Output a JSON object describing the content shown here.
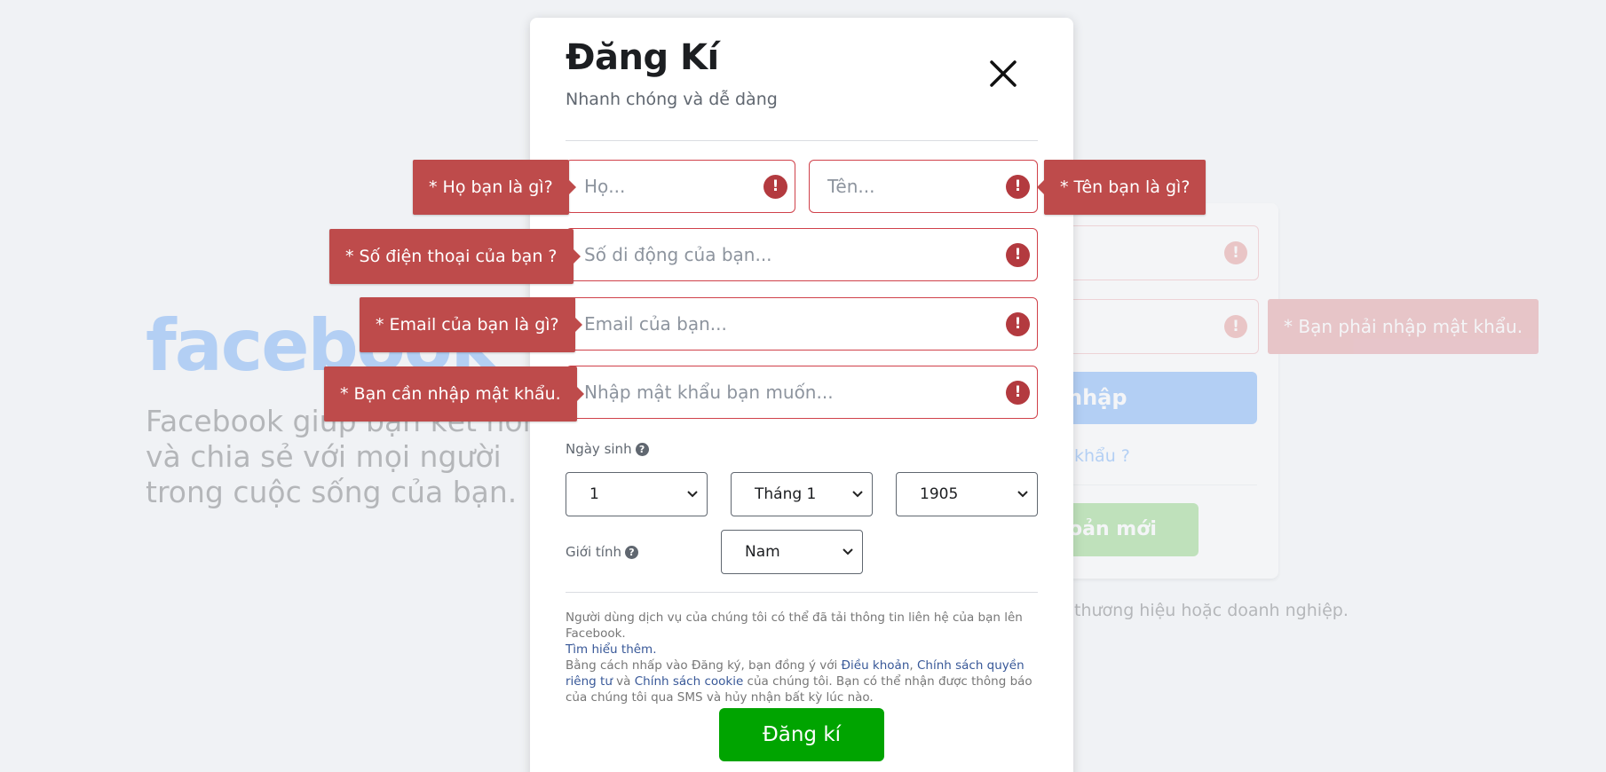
{
  "background": {
    "logo": "facebook",
    "tagline": "Facebook giúp bạn kết nối và chia sẻ với mọi người trong cuộc sống của bạn.",
    "password_tooltip": "* Bạn phải nhập mật khẩu.",
    "login_button": "nhập",
    "forgot_password": "khẩu ?",
    "create_account_button": "oản mới",
    "footer_note": "thương hiệu hoặc doanh nghiệp."
  },
  "modal": {
    "title": "Đăng Kí",
    "subtitle": "Nhanh chóng và dễ dàng",
    "fields": {
      "last_name": {
        "placeholder": "Họ...",
        "value": "",
        "error": "* Họ bạn là gì?"
      },
      "first_name": {
        "placeholder": "Tên...",
        "value": "",
        "error": "* Tên bạn là gì?"
      },
      "phone": {
        "placeholder": "Số di động của bạn...",
        "value": "",
        "error": "* Số điện thoại của bạn ?"
      },
      "email": {
        "placeholder": "Email của bạn...",
        "value": "",
        "error": "* Email của bạn là gì?"
      },
      "password": {
        "placeholder": "Nhập mật khẩu bạn muốn...",
        "value": "",
        "error": "* Bạn cần nhập mật khẩu."
      }
    },
    "alert_glyph": "!",
    "birthday": {
      "label": "Ngày sinh",
      "day": "1",
      "month": "Tháng 1",
      "year": "1905"
    },
    "gender": {
      "label": "Giới tính",
      "value": "Nam"
    },
    "help_glyph": "?",
    "legal": {
      "line1": "Người dùng dịch vụ của chúng tôi có thể đã tải thông tin liên hệ của bạn lên Facebook.",
      "learn_more": "Tìm hiểu thêm.",
      "line2_pre": "Bằng cách nhấp vào Đăng ký, bạn đồng ý với ",
      "terms": "Điều khoản",
      "sep": ", ",
      "privacy": "Chính sách quyền riêng tư",
      "and": " và ",
      "cookie": "Chính sách cookie",
      "line2_post": " của chúng tôi. Bạn có thể nhận được thông báo của chúng tôi qua SMS và hủy nhận bất kỳ lúc nào."
    },
    "signup_button": "Đăng kí"
  },
  "colors": {
    "error": "#be4b4b",
    "signup_green": "#00a400",
    "link": "#385898",
    "brand_blue": "#1877f2"
  },
  "icons": [
    "close-icon",
    "alert-icon",
    "help-icon",
    "chevron-down-icon"
  ]
}
